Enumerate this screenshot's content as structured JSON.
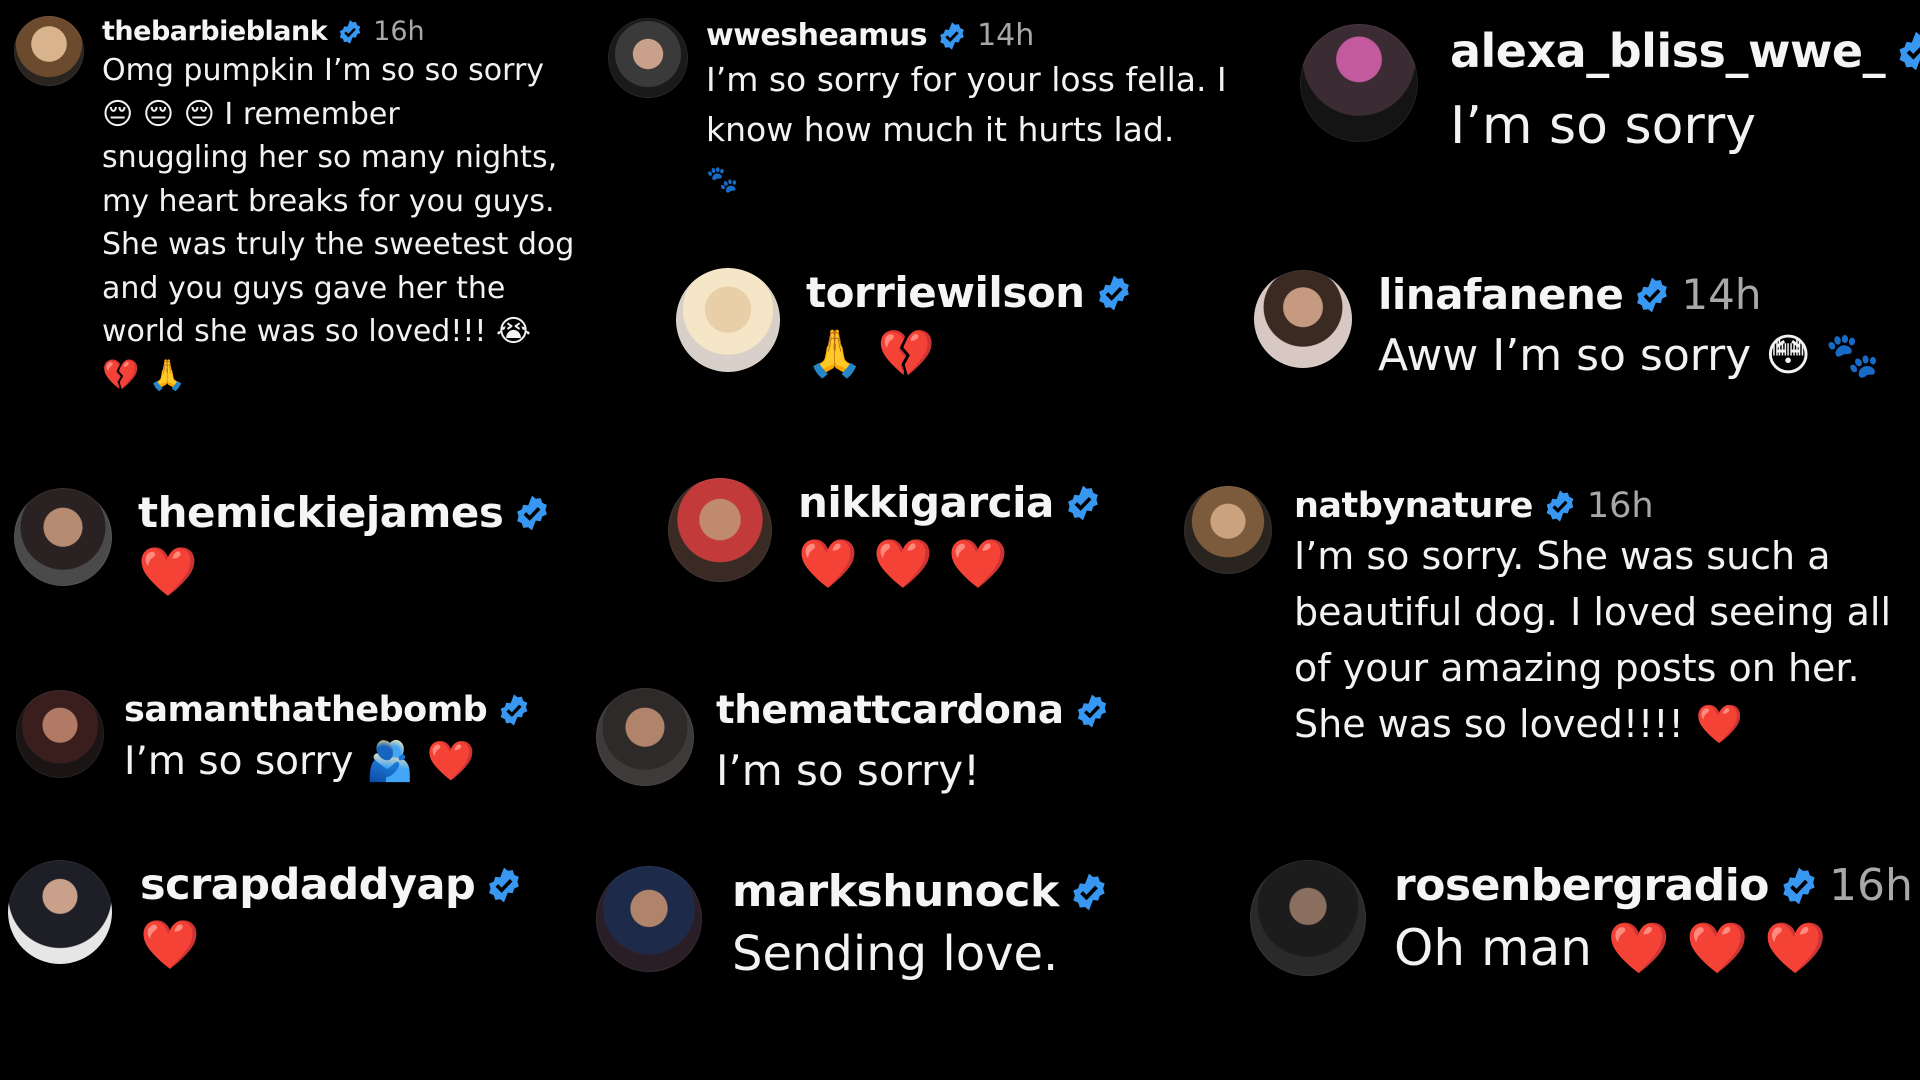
{
  "colors": {
    "background": "#000000",
    "verified": "#3897f0",
    "heart": "#ff3b6b",
    "time": "#a8a8a8"
  },
  "comments": [
    {
      "user": "thebarbieblank",
      "time": "16h",
      "lines": [
        "Omg pumpkin I’m so so sorry",
        "😔 😔 😔 I remember",
        "snuggling her so many nights,",
        "my heart breaks for you guys.",
        "She was truly the sweetest dog",
        "and you guys gave her the",
        "world she was so loved!!! 😭",
        "💔 🙏"
      ]
    },
    {
      "user": "wwesheamus",
      "time": "14h",
      "lines": [
        "I’m so sorry for your loss fella. I",
        "know how much it hurts lad.",
        "🐾"
      ]
    },
    {
      "user": "alexa_bliss_wwe_",
      "time": "",
      "lines": [
        "I’m so sorry"
      ]
    },
    {
      "user": "torriewilson",
      "time": "",
      "lines": [
        "🙏 💔"
      ]
    },
    {
      "user": "linafanene",
      "time": "14h",
      "lines": [
        "Aww I’m so sorry 😳 🐾"
      ]
    },
    {
      "user": "themickiejames",
      "time": "",
      "lines": [
        "❤️"
      ]
    },
    {
      "user": "nikkigarcia",
      "time": "",
      "lines": [
        "❤️ ❤️ ❤️"
      ]
    },
    {
      "user": "natbynature",
      "time": "16h",
      "lines": [
        "I’m so sorry. She was such a",
        "beautiful dog. I loved seeing all",
        "of your amazing posts on her.",
        "She was so loved!!!! ❤️"
      ]
    },
    {
      "user": "samanthathebomb",
      "time": "",
      "lines": [
        "I’m so sorry 🫂 ❤️"
      ]
    },
    {
      "user": "themattcardona",
      "time": "",
      "lines": [
        "I’m so sorry!"
      ]
    },
    {
      "user": "scrapdaddyap",
      "time": "",
      "lines": [
        "❤️"
      ]
    },
    {
      "user": "markshunock",
      "time": "",
      "lines": [
        "Sending love."
      ]
    },
    {
      "user": "rosenbergradio",
      "time": "16h",
      "lines": [
        "Oh man ❤️ ❤️ ❤️"
      ]
    }
  ]
}
